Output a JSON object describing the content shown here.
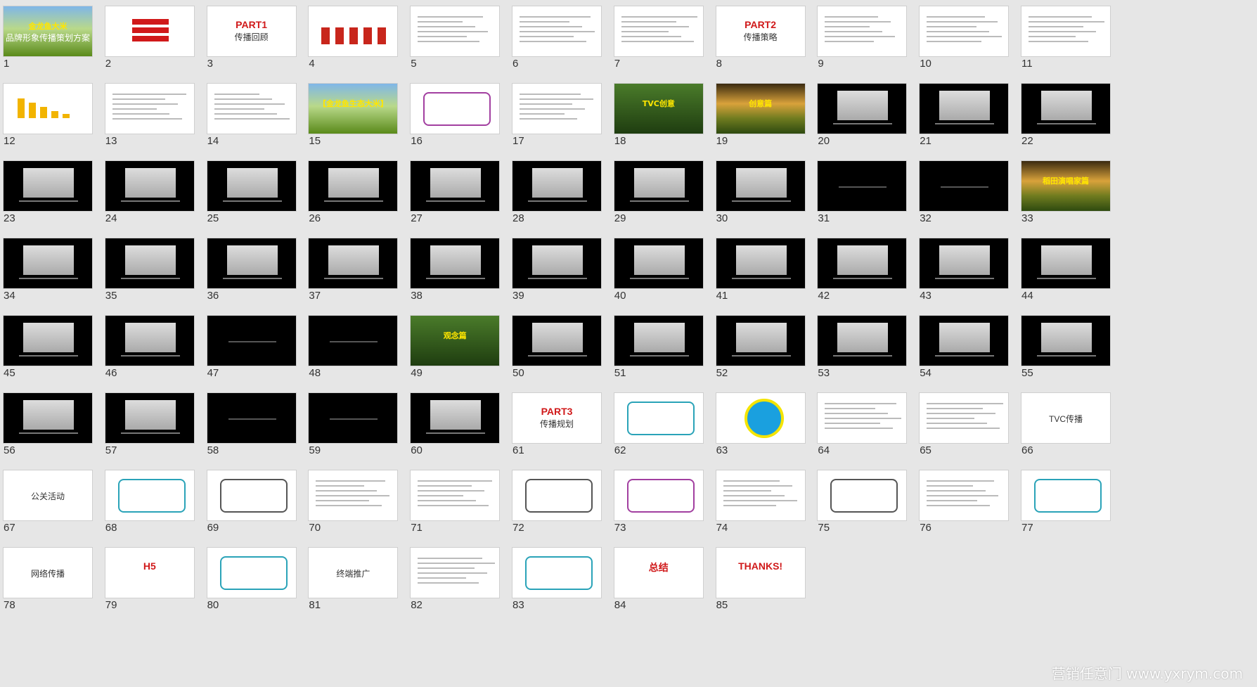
{
  "slides": [
    {
      "n": "1",
      "bg": "field",
      "title": "金龙鱼大米",
      "sub": "品牌形象传播策划方案"
    },
    {
      "n": "2",
      "bg": "white",
      "style": "redlist"
    },
    {
      "n": "3",
      "bg": "white",
      "title": "PART1",
      "sub": "传播回顾"
    },
    {
      "n": "4",
      "bg": "white",
      "style": "product"
    },
    {
      "n": "5",
      "bg": "white",
      "style": "text"
    },
    {
      "n": "6",
      "bg": "white",
      "style": "text"
    },
    {
      "n": "7",
      "bg": "white",
      "style": "text"
    },
    {
      "n": "8",
      "bg": "white",
      "title": "PART2",
      "sub": "传播策略"
    },
    {
      "n": "9",
      "bg": "white",
      "style": "text"
    },
    {
      "n": "10",
      "bg": "white",
      "style": "text"
    },
    {
      "n": "11",
      "bg": "white",
      "style": "text"
    },
    {
      "n": "12",
      "bg": "white",
      "style": "bars"
    },
    {
      "n": "13",
      "bg": "white",
      "style": "table"
    },
    {
      "n": "14",
      "bg": "white",
      "style": "text"
    },
    {
      "n": "15",
      "bg": "field",
      "title": "【金龙鱼生态大米】"
    },
    {
      "n": "16",
      "bg": "white",
      "style": "box"
    },
    {
      "n": "17",
      "bg": "white",
      "style": "text"
    },
    {
      "n": "18",
      "bg": "green",
      "title": "TVC创意"
    },
    {
      "n": "19",
      "bg": "sunset",
      "title": "创意篇"
    },
    {
      "n": "20",
      "bg": "black",
      "style": "scene"
    },
    {
      "n": "21",
      "bg": "black",
      "style": "scene"
    },
    {
      "n": "22",
      "bg": "black",
      "style": "scene"
    },
    {
      "n": "23",
      "bg": "black",
      "style": "scene"
    },
    {
      "n": "24",
      "bg": "black",
      "style": "scene"
    },
    {
      "n": "25",
      "bg": "black",
      "style": "scene"
    },
    {
      "n": "26",
      "bg": "black",
      "style": "scene"
    },
    {
      "n": "27",
      "bg": "black",
      "style": "scene"
    },
    {
      "n": "28",
      "bg": "black",
      "style": "scene"
    },
    {
      "n": "29",
      "bg": "black",
      "style": "scene"
    },
    {
      "n": "30",
      "bg": "black",
      "style": "scene"
    },
    {
      "n": "31",
      "bg": "black",
      "style": "dark"
    },
    {
      "n": "32",
      "bg": "black",
      "style": "dark"
    },
    {
      "n": "33",
      "bg": "sunset",
      "title": "稻田演唱家篇"
    },
    {
      "n": "34",
      "bg": "black",
      "style": "scene"
    },
    {
      "n": "35",
      "bg": "black",
      "style": "scene"
    },
    {
      "n": "36",
      "bg": "black",
      "style": "scene"
    },
    {
      "n": "37",
      "bg": "black",
      "style": "scene"
    },
    {
      "n": "38",
      "bg": "black",
      "style": "scene"
    },
    {
      "n": "39",
      "bg": "black",
      "style": "scene"
    },
    {
      "n": "40",
      "bg": "black",
      "style": "scene"
    },
    {
      "n": "41",
      "bg": "black",
      "style": "scene"
    },
    {
      "n": "42",
      "bg": "black",
      "style": "scene"
    },
    {
      "n": "43",
      "bg": "black",
      "style": "scene"
    },
    {
      "n": "44",
      "bg": "black",
      "style": "scene"
    },
    {
      "n": "45",
      "bg": "black",
      "style": "scene"
    },
    {
      "n": "46",
      "bg": "black",
      "style": "scene"
    },
    {
      "n": "47",
      "bg": "black",
      "style": "dark"
    },
    {
      "n": "48",
      "bg": "black",
      "style": "dark"
    },
    {
      "n": "49",
      "bg": "green",
      "title": "观念篇"
    },
    {
      "n": "50",
      "bg": "black",
      "style": "scene"
    },
    {
      "n": "51",
      "bg": "black",
      "style": "scene"
    },
    {
      "n": "52",
      "bg": "black",
      "style": "scene"
    },
    {
      "n": "53",
      "bg": "black",
      "style": "scene"
    },
    {
      "n": "54",
      "bg": "black",
      "style": "scene"
    },
    {
      "n": "55",
      "bg": "black",
      "style": "scene"
    },
    {
      "n": "56",
      "bg": "black",
      "style": "scene"
    },
    {
      "n": "57",
      "bg": "black",
      "style": "scene"
    },
    {
      "n": "58",
      "bg": "black",
      "style": "dark"
    },
    {
      "n": "59",
      "bg": "black",
      "style": "dark"
    },
    {
      "n": "60",
      "bg": "black",
      "style": "scene"
    },
    {
      "n": "61",
      "bg": "white",
      "title": "PART3",
      "sub": "传播规划"
    },
    {
      "n": "62",
      "bg": "white",
      "style": "box"
    },
    {
      "n": "63",
      "bg": "white",
      "style": "circle"
    },
    {
      "n": "64",
      "bg": "white",
      "style": "text"
    },
    {
      "n": "65",
      "bg": "white",
      "style": "text"
    },
    {
      "n": "66",
      "bg": "white",
      "sub": "TVC传播"
    },
    {
      "n": "67",
      "bg": "white",
      "sub": "公关活动"
    },
    {
      "n": "68",
      "bg": "white",
      "style": "box"
    },
    {
      "n": "69",
      "bg": "white",
      "style": "box"
    },
    {
      "n": "70",
      "bg": "white",
      "style": "text"
    },
    {
      "n": "71",
      "bg": "white",
      "style": "text"
    },
    {
      "n": "72",
      "bg": "white",
      "style": "box"
    },
    {
      "n": "73",
      "bg": "white",
      "style": "box"
    },
    {
      "n": "74",
      "bg": "white",
      "style": "table"
    },
    {
      "n": "75",
      "bg": "white",
      "style": "box"
    },
    {
      "n": "76",
      "bg": "white",
      "style": "text"
    },
    {
      "n": "77",
      "bg": "white",
      "style": "box"
    },
    {
      "n": "78",
      "bg": "white",
      "sub": "网络传播"
    },
    {
      "n": "79",
      "bg": "white",
      "title": "H5"
    },
    {
      "n": "80",
      "bg": "white",
      "style": "box"
    },
    {
      "n": "81",
      "bg": "white",
      "sub": "终端推广"
    },
    {
      "n": "82",
      "bg": "white",
      "style": "text"
    },
    {
      "n": "83",
      "bg": "white",
      "style": "box"
    },
    {
      "n": "84",
      "bg": "white",
      "title": "总结"
    },
    {
      "n": "85",
      "bg": "white",
      "title": "THANKS!"
    }
  ],
  "watermark": "营销任意门 www.yxrym.com"
}
